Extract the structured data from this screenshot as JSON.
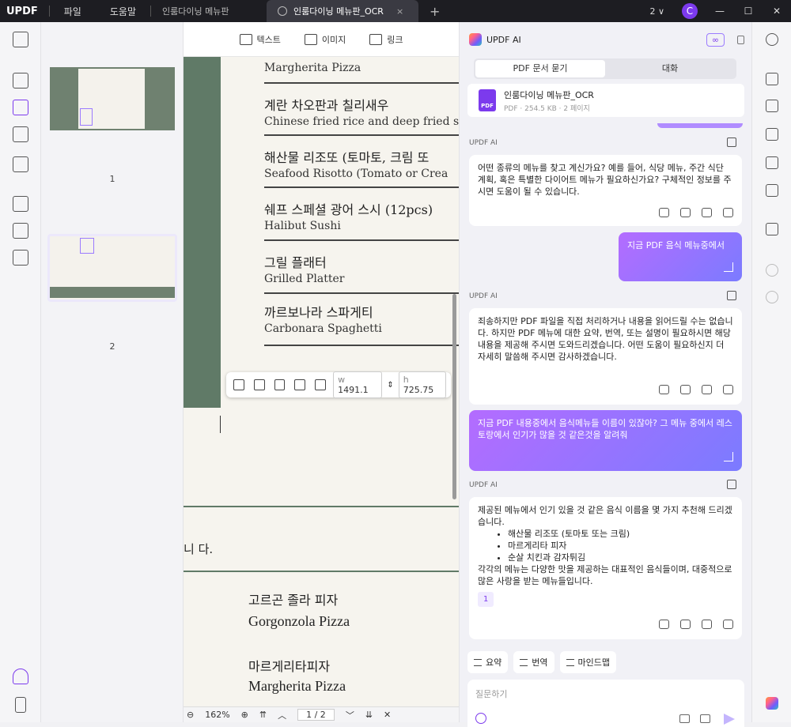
{
  "titlebar": {
    "logo": "UPDF",
    "menu_file": "파일",
    "menu_help": "도움말",
    "tab1": "인룸다이닝 메뉴판",
    "tab2": "인룸다이닝 메뉴판_OCR",
    "tab_close": "×",
    "new_tab": "+",
    "count": "2 ∨",
    "avatar": "C"
  },
  "toolbar": {
    "text": "텍스트",
    "image": "이미지",
    "link": "링크"
  },
  "thumbs": {
    "p1": "1",
    "p2": "2"
  },
  "doc": {
    "items": [
      {
        "ko": "",
        "en": "Margherita Pizza"
      },
      {
        "ko": "계란 차오판과 칠리새우",
        "en": "Chinese fried rice and deep fried s"
      },
      {
        "ko": "해산물 리조또 (토마토, 크림 또",
        "en": "Seafood Risotto (Tomato or Crea"
      },
      {
        "ko": "쉐프 스페셜 광어 스시 (12pcs)",
        "en": "Halibut Sushi"
      },
      {
        "ko": "그릴 플래터",
        "en": "Grilled Platter"
      },
      {
        "ko": "까르보나라 스파게티",
        "en": "Carbonara Spaghetti"
      }
    ],
    "page2_text": "니 다.",
    "gorgonzola_ko": "고르곤 졸라 피자",
    "gorgonzola_en": "Gorgonzola Pizza",
    "margherita_ko": "마르게리타피자",
    "margherita_en": "Margherita Pizza",
    "width_label": "w",
    "width_value": "1491.1",
    "height_label": "h",
    "height_value": "725.75",
    "zoom": "162%",
    "page_indicator": "1 / 2"
  },
  "ai": {
    "title": "UPDF AI",
    "seg_pdf": "PDF 문서 묻기",
    "seg_chat": "대화",
    "file_name": "인룸다이닝 메뉴판_OCR",
    "file_meta": "PDF · 254.5 KB · 2 페이지",
    "label": "UPDF AI",
    "msg1": "어떤 종류의 메뉴를 찾고 계신가요? 예를 들어, 식당 메뉴, 주간 식단 계획, 혹은 특별한 다이어트 메뉴가 필요하신가요? 구체적인 정보를 주시면 도움이 될 수 있습니다.",
    "user1": "지금 PDF 음식 메뉴중에서",
    "msg2": "죄송하지만 PDF 파일을 직접 처리하거나 내용을 읽어드릴 수는 없습니다. 하지만 PDF 메뉴에 대한 요약, 번역, 또는 설명이 필요하시면 해당 내용을 제공해 주시면 도와드리겠습니다. 어떤 도움이 필요하신지 더 자세히 말씀해 주시면 감사하겠습니다.",
    "user2": "지금 PDF 내용중에서 음식메뉴들 이름이 있잖아? 그 메뉴 중에서 레스토랑에서 인기가 많을 것 같은것을 알려줘",
    "msg3_intro": "제공된 메뉴에서 인기 있을 것 같은 음식 이름을 몇 가지 추천해 드리겠습니다.",
    "msg3_list": [
      "해산물 리조또 (토마토 또는 크림)",
      "마르게리타 피자",
      "순살 치킨과 감자튀김"
    ],
    "msg3_outro": "각각의 메뉴는 다양한 맛을 제공하는 대표적인 음식들이며, 대중적으로 많은 사랑을 받는 메뉴들입니다.",
    "citation": "1",
    "chip_summary": "요약",
    "chip_translate": "번역",
    "chip_mindmap": "마인드맵",
    "input_placeholder": "질문하기"
  }
}
